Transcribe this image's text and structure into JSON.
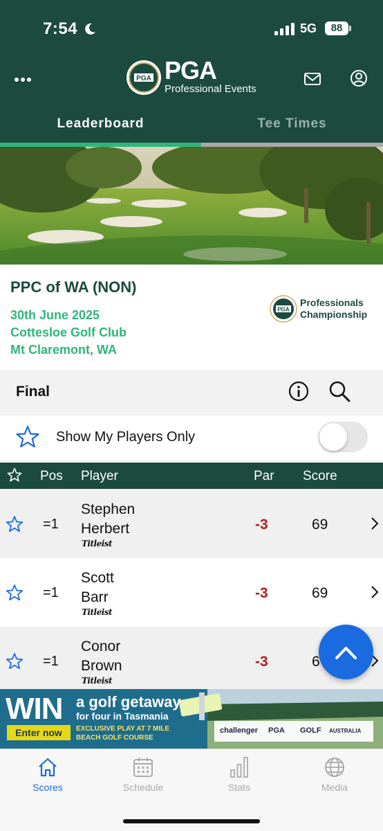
{
  "status_bar": {
    "time": "7:54",
    "network": "5G",
    "battery": "88"
  },
  "header": {
    "logo_text": "PGA",
    "logo_subtitle": "Professional Events",
    "icons": [
      "more-dots-icon",
      "mail-icon",
      "user-icon"
    ]
  },
  "tabs": [
    {
      "label": "Leaderboard",
      "active": true
    },
    {
      "label": "Tee Times",
      "active": false
    }
  ],
  "tournament": {
    "title": "PPC of WA (NON)",
    "date": "30th June 2025",
    "venue": "Cottesloe Golf Club",
    "location": "Mt Claremont, WA",
    "badge_line1": "Professionals",
    "badge_line2": "Championship"
  },
  "round_status": "Final",
  "filter": {
    "label": "Show My Players Only",
    "enabled": false
  },
  "table": {
    "headers": {
      "pos": "Pos",
      "player": "Player",
      "par": "Par",
      "score": "Score"
    },
    "rows": [
      {
        "pos": "=1",
        "first": "Stephen",
        "last": "Herbert",
        "sponsor": "Titleist",
        "par": "-3",
        "score": "69"
      },
      {
        "pos": "=1",
        "first": "Scott",
        "last": "Barr",
        "sponsor": "Titleist",
        "par": "-3",
        "score": "69"
      },
      {
        "pos": "=1",
        "first": "Conor",
        "last": "Brown",
        "sponsor": "Titleist",
        "par": "-3",
        "score": "6"
      }
    ]
  },
  "ad": {
    "headline": "WIN",
    "line1": "a golf getaway",
    "line2": "for four in Tasmania",
    "cta": "Enter now",
    "fine_print": "EXCLUSIVE PLAY AT 7 MILE BEACH GOLF COURSE",
    "sponsors": [
      "challenger",
      "PGA",
      "GOLF",
      "AUSTRALIA"
    ]
  },
  "bottom_nav": [
    {
      "label": "Scores",
      "icon": "home-icon",
      "active": true
    },
    {
      "label": "Schedule",
      "icon": "calendar-icon",
      "active": false
    },
    {
      "label": "Stats",
      "icon": "bar-chart-icon",
      "active": false
    },
    {
      "label": "Media",
      "icon": "globe-icon",
      "active": false
    }
  ],
  "colors": {
    "brand_green": "#1c4a3f",
    "accent_green": "#2fb67c",
    "over_par_red": "#b01f1f",
    "link_blue": "#1a6ae0"
  }
}
